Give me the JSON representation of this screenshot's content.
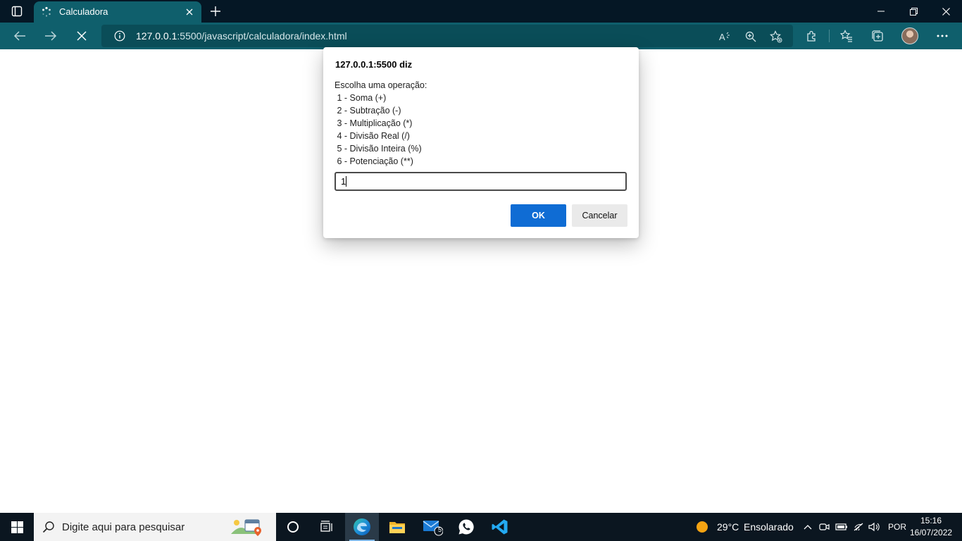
{
  "browser": {
    "tab_title": "Calculadora",
    "url_host": "127.0.0.1",
    "url_rest": ":5500/javascript/calculadora/index.html"
  },
  "dialog": {
    "heading": "127.0.0.1:5500 diz",
    "message_lines": [
      "Escolha uma operação:",
      " 1 - Soma (+)",
      " 2 - Subtração (-)",
      " 3 - Multiplicação (*)",
      " 4 - Divisão Real (/)",
      " 5 - Divisão Inteira (%)",
      " 6 - Potenciação (**)"
    ],
    "input_value": "1",
    "ok_label": "OK",
    "cancel_label": "Cancelar"
  },
  "taskbar": {
    "search_placeholder": "Digite aqui para pesquisar",
    "mail_badge": "5",
    "weather_temp": "29°C",
    "weather_desc": "Ensolarado",
    "language": "POR",
    "time": "15:16",
    "date": "16/07/2022"
  },
  "colors": {
    "titlebar": "#051725",
    "toolbar": "#0f5f6c",
    "ok_button": "#0f6cd4",
    "taskbar": "#0b1620"
  }
}
